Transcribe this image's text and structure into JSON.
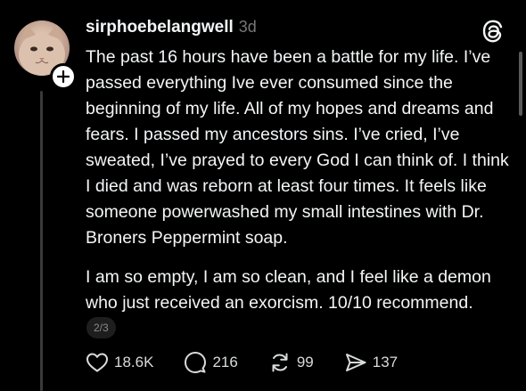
{
  "post": {
    "username": "sirphoebelangwell",
    "timestamp": "3d",
    "paragraphs": [
      "The past 16 hours have been a battle for my life. I’ve passed everything Ive ever consumed since the beginning of my life. All of my hopes and dreams and fears. I passed my ancestors sins. I’ve cried, I’ve sweated, I’ve prayed to every God I can think of. I think I died and was reborn at least four times. It feels like someone powerwashed my small intestines with Dr. Broners Peppermint soap.",
      "I am so empty, I am so clean, and I feel like a demon who just received an exorcism. 10/10 recommend."
    ],
    "page_indicator": "2/3"
  },
  "actions": {
    "likes": "18.6K",
    "replies": "216",
    "reposts": "99",
    "shares": "137"
  },
  "icons": {
    "avatar": "cat-avatar",
    "follow": "plus-icon",
    "brand": "threads-logo-icon",
    "like": "heart-icon",
    "reply": "comment-icon",
    "repost": "repost-icon",
    "share": "send-icon"
  },
  "colors": {
    "background": "#000000",
    "text": "#f3f5f7",
    "muted": "#777777"
  }
}
